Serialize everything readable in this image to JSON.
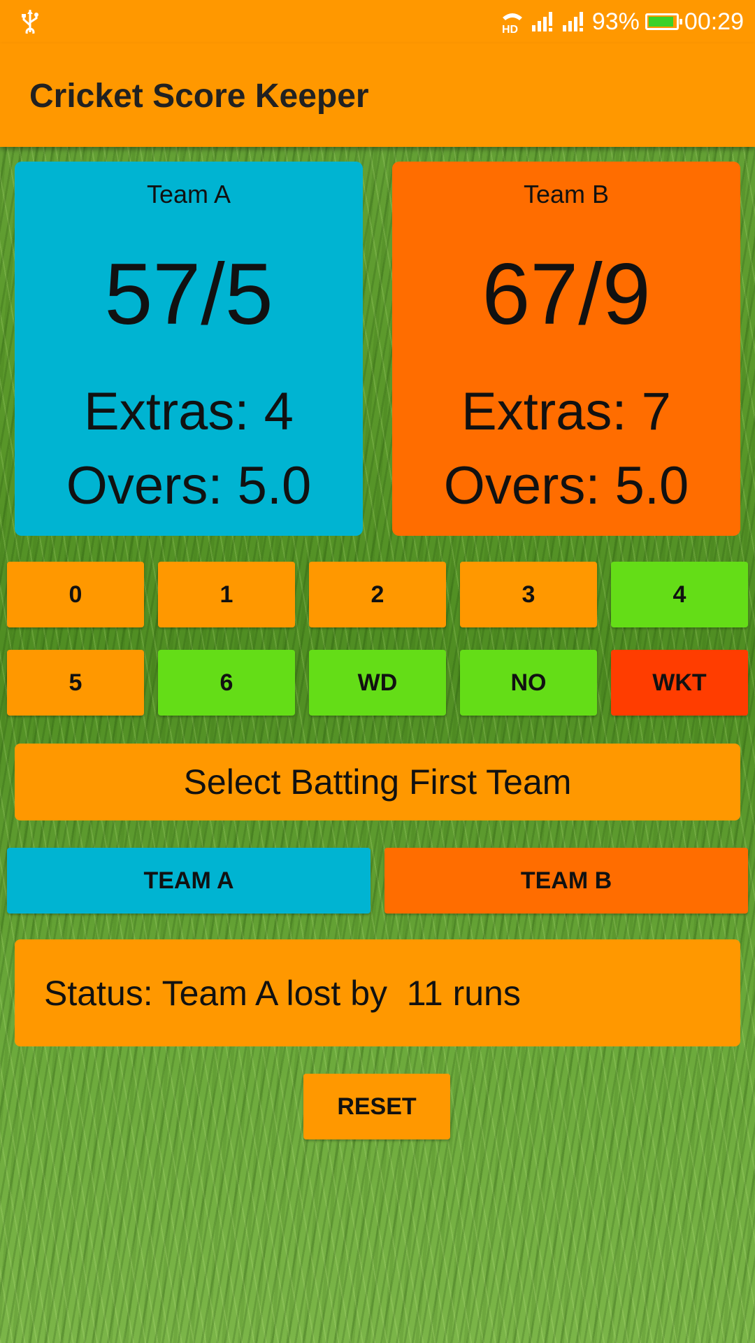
{
  "status_bar": {
    "usb_icon": "usb-icon",
    "hd_label": "HD",
    "battery": "93%",
    "battery_level": 0.93,
    "time": "00:29",
    "battery_color": "#39d12a"
  },
  "app_bar": {
    "title": "Cricket Score Keeper",
    "color": "#ff9800"
  },
  "teams": [
    {
      "name": "Team A",
      "score": "57/5",
      "extras": "Extras: 4",
      "overs": "Overs: 5.0",
      "color": "#00b4d2"
    },
    {
      "name": "Team B",
      "score": "67/9",
      "extras": "Extras: 7",
      "overs": "Overs: 5.0",
      "color": "#ff6d00"
    }
  ],
  "run_buttons": [
    {
      "label": "0",
      "color": "#ff9800"
    },
    {
      "label": "1",
      "color": "#ff9800"
    },
    {
      "label": "2",
      "color": "#ff9800"
    },
    {
      "label": "3",
      "color": "#ff9800"
    },
    {
      "label": "4",
      "color": "#64dd17"
    },
    {
      "label": "5",
      "color": "#ff9800"
    },
    {
      "label": "6",
      "color": "#64dd17"
    },
    {
      "label": "WD",
      "color": "#64dd17"
    },
    {
      "label": "NO",
      "color": "#64dd17"
    },
    {
      "label": "WKT",
      "color": "#ff3d00"
    }
  ],
  "select_label": "Select Batting First Team",
  "team_buttons": {
    "a": "TEAM A",
    "b": "TEAM B"
  },
  "status_text": "Status: Team A lost by  11 runs",
  "reset_label": "RESET"
}
